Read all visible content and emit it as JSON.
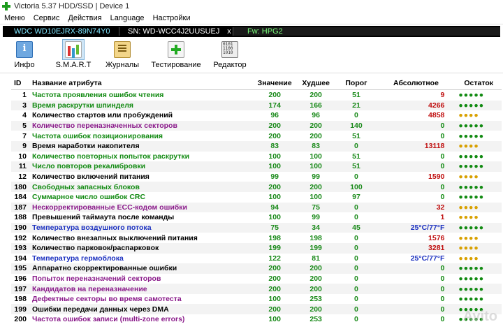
{
  "window": {
    "title": "Victoria 5.37 HDD/SSD | Device 1"
  },
  "menu": [
    "Меню",
    "Сервис",
    "Действия",
    "Language",
    "Настройки"
  ],
  "device": {
    "model": "WDC WD10EJRX-89N74Y0",
    "serial": "SN: WD-WCC4J2UUSUEJ",
    "close": "x",
    "firmware": "Fw: HPG2"
  },
  "toolbar": [
    {
      "label": "Инфо",
      "icon": "info-icon"
    },
    {
      "label": "S.M.A.R.T",
      "icon": "smart-icon",
      "active": true
    },
    {
      "label": "Журналы",
      "icon": "logs-icon"
    },
    {
      "label": "Тестирование",
      "icon": "test-icon"
    },
    {
      "label": "Редактор",
      "icon": "editor-icon"
    }
  ],
  "table": {
    "headers": [
      "ID",
      "Название атрибута",
      "Значение",
      "Худшее",
      "Порог",
      "Абсолютное",
      "Остаток"
    ],
    "rows": [
      {
        "id": "1",
        "name": "Частота проявления ошибок чтения",
        "nc": "g",
        "value": "200",
        "worst": "200",
        "thr": "51",
        "abs": "9",
        "ac": "r",
        "left": "●●●●●",
        "lc": "g"
      },
      {
        "id": "3",
        "name": "Время раскрутки шпинделя",
        "nc": "g",
        "value": "174",
        "worst": "166",
        "thr": "21",
        "abs": "4266",
        "ac": "r",
        "left": "●●●●●",
        "lc": "g"
      },
      {
        "id": "4",
        "name": "Количество стартов или пробуждений",
        "nc": "k",
        "value": "96",
        "worst": "96",
        "thr": "0",
        "abs": "4858",
        "ac": "r",
        "left": "●●●●",
        "lc": "y"
      },
      {
        "id": "5",
        "name": "Количество переназначенных секторов",
        "nc": "p",
        "value": "200",
        "worst": "200",
        "thr": "140",
        "abs": "0",
        "ac": "g",
        "left": "●●●●●",
        "lc": "g"
      },
      {
        "id": "7",
        "name": "Частота ошибок позиционирования",
        "nc": "g",
        "value": "200",
        "worst": "200",
        "thr": "51",
        "abs": "0",
        "ac": "g",
        "left": "●●●●●",
        "lc": "g"
      },
      {
        "id": "9",
        "name": "Время наработки накопителя",
        "nc": "k",
        "value": "83",
        "worst": "83",
        "thr": "0",
        "abs": "13118",
        "ac": "r",
        "left": "●●●●",
        "lc": "y"
      },
      {
        "id": "10",
        "name": "Количество повторных попыток раскрутки",
        "nc": "g",
        "value": "100",
        "worst": "100",
        "thr": "51",
        "abs": "0",
        "ac": "g",
        "left": "●●●●●",
        "lc": "g"
      },
      {
        "id": "11",
        "name": "Число повторов рекалибровки",
        "nc": "g",
        "value": "100",
        "worst": "100",
        "thr": "51",
        "abs": "0",
        "ac": "g",
        "left": "●●●●●",
        "lc": "g"
      },
      {
        "id": "12",
        "name": "Количество включений питания",
        "nc": "k",
        "value": "99",
        "worst": "99",
        "thr": "0",
        "abs": "1590",
        "ac": "r",
        "left": "●●●●",
        "lc": "y"
      },
      {
        "id": "180",
        "name": "Свободных запасных блоков",
        "nc": "g",
        "value": "200",
        "worst": "200",
        "thr": "100",
        "abs": "0",
        "ac": "g",
        "left": "●●●●●",
        "lc": "g"
      },
      {
        "id": "184",
        "name": "Суммарное число ошибок CRC",
        "nc": "g",
        "value": "100",
        "worst": "100",
        "thr": "97",
        "abs": "0",
        "ac": "g",
        "left": "●●●●●",
        "lc": "g"
      },
      {
        "id": "187",
        "name": "Нескорректированные ECC-кодом ошибки",
        "nc": "p",
        "value": "94",
        "worst": "75",
        "thr": "0",
        "abs": "32",
        "ac": "r",
        "left": "●●●●",
        "lc": "y"
      },
      {
        "id": "188",
        "name": "Превышений таймаута после команды",
        "nc": "k",
        "value": "100",
        "worst": "99",
        "thr": "0",
        "abs": "1",
        "ac": "r",
        "left": "●●●●",
        "lc": "y"
      },
      {
        "id": "190",
        "name": "Температура воздушного потока",
        "nc": "b",
        "value": "75",
        "worst": "34",
        "thr": "45",
        "abs": "25°C/77°F",
        "ac": "b",
        "left": "●●●●●",
        "lc": "g"
      },
      {
        "id": "192",
        "name": "Количество внезапных выключений питания",
        "nc": "k",
        "value": "198",
        "worst": "198",
        "thr": "0",
        "abs": "1576",
        "ac": "r",
        "left": "●●●●",
        "lc": "y"
      },
      {
        "id": "193",
        "name": "Количество парковок/распарковок",
        "nc": "k",
        "value": "199",
        "worst": "199",
        "thr": "0",
        "abs": "3281",
        "ac": "r",
        "left": "●●●●",
        "lc": "y"
      },
      {
        "id": "194",
        "name": "Температура гермоблока",
        "nc": "b",
        "value": "122",
        "worst": "81",
        "thr": "0",
        "abs": "25°C/77°F",
        "ac": "b",
        "left": "●●●●",
        "lc": "y"
      },
      {
        "id": "195",
        "name": "Аппаратно скорректированные ошибки",
        "nc": "k",
        "value": "200",
        "worst": "200",
        "thr": "0",
        "abs": "0",
        "ac": "g",
        "left": "●●●●●",
        "lc": "g"
      },
      {
        "id": "196",
        "name": "Попыток переназначений секторов",
        "nc": "p",
        "value": "200",
        "worst": "200",
        "thr": "0",
        "abs": "0",
        "ac": "g",
        "left": "●●●●●",
        "lc": "g"
      },
      {
        "id": "197",
        "name": "Кандидатов на переназначение",
        "nc": "p",
        "value": "200",
        "worst": "200",
        "thr": "0",
        "abs": "0",
        "ac": "g",
        "left": "●●●●●",
        "lc": "g"
      },
      {
        "id": "198",
        "name": "Дефектные секторы во время самотеста",
        "nc": "p",
        "value": "100",
        "worst": "253",
        "thr": "0",
        "abs": "0",
        "ac": "g",
        "left": "●●●●●",
        "lc": "g"
      },
      {
        "id": "199",
        "name": "Ошибки передачи данных через DMA",
        "nc": "k",
        "value": "200",
        "worst": "200",
        "thr": "0",
        "abs": "0",
        "ac": "g",
        "left": "●●●●●",
        "lc": "g"
      },
      {
        "id": "200",
        "name": "Частота ошибок записи (multi-zone errors)",
        "nc": "p",
        "value": "100",
        "worst": "253",
        "thr": "0",
        "abs": "0",
        "ac": "g",
        "left": "●●●●●",
        "lc": "g"
      }
    ]
  },
  "watermark": "Avito"
}
